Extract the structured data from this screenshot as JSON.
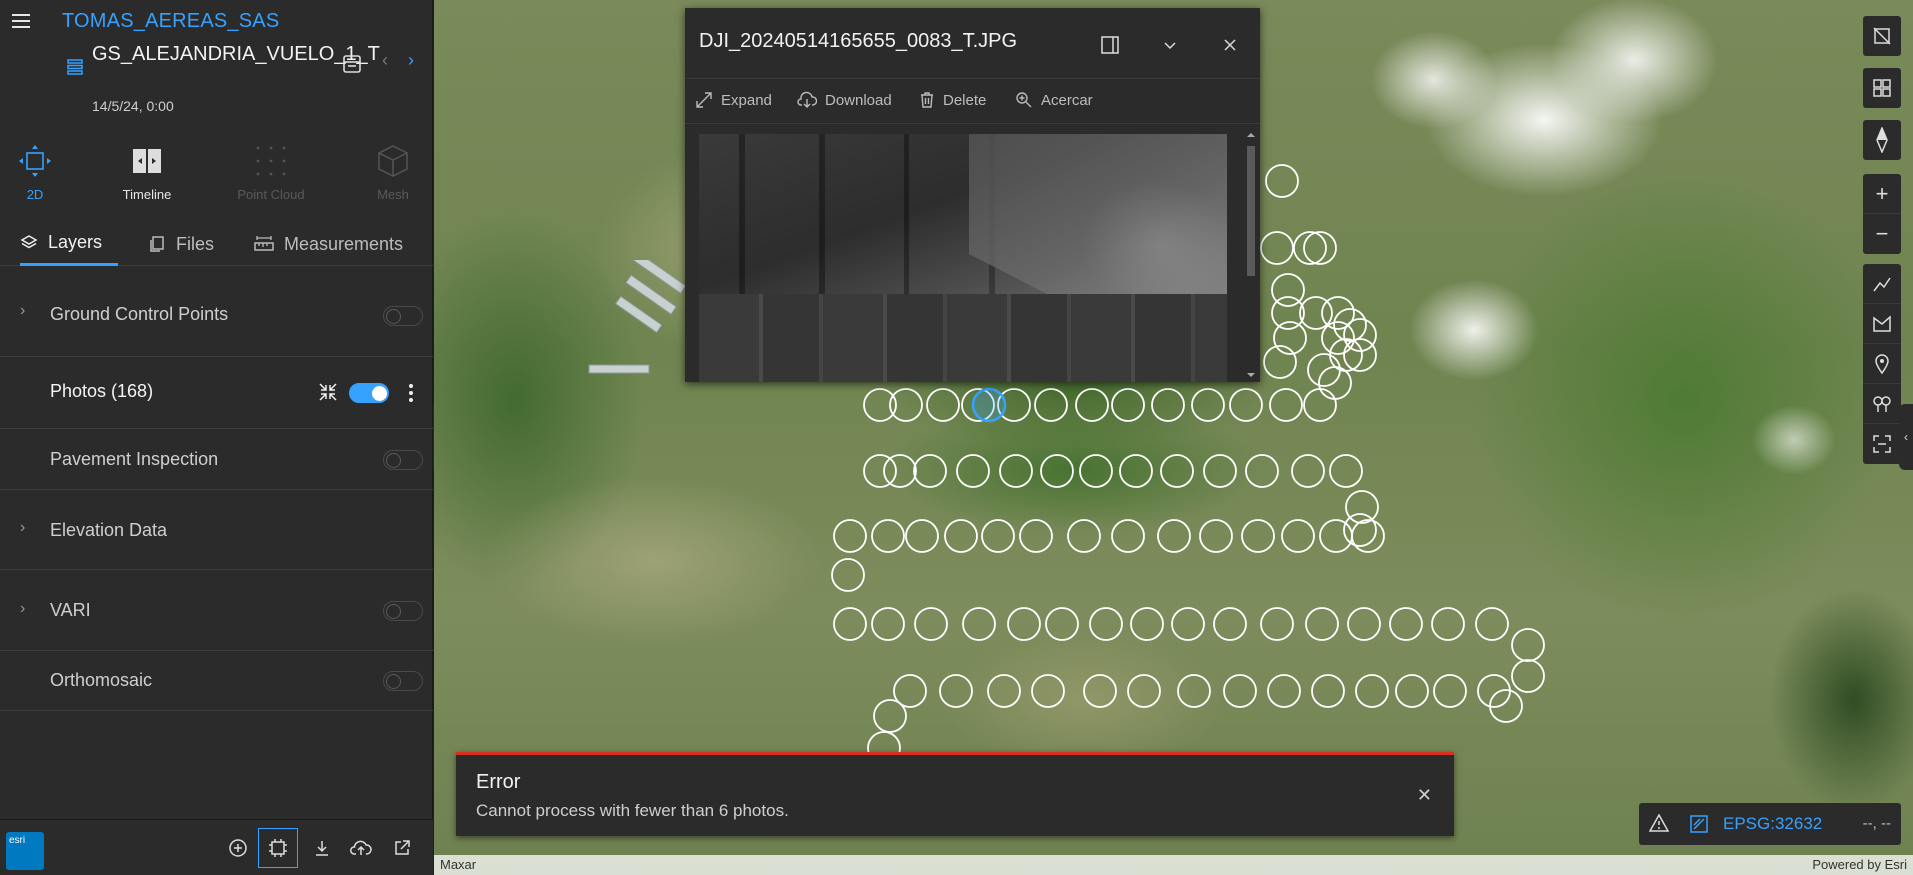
{
  "header": {
    "org": "TOMAS_AEREAS_SAS",
    "project": "GS_ALEJANDRIA_VUELO_1_T",
    "date": "14/5/24, 0:00"
  },
  "modes": [
    {
      "label": "2D",
      "state": "active"
    },
    {
      "label": "Timeline",
      "state": "enabled"
    },
    {
      "label": "Point Cloud",
      "state": "disabled"
    },
    {
      "label": "Mesh",
      "state": "disabled"
    }
  ],
  "tabs": [
    {
      "label": "Layers",
      "active": true
    },
    {
      "label": "Files",
      "active": false
    },
    {
      "label": "Measurements",
      "active": false
    }
  ],
  "layers": [
    {
      "name": "Ground Control Points",
      "expandable": true,
      "visible": false
    },
    {
      "name": "Photos (168)",
      "expandable": false,
      "visible": true
    },
    {
      "name": "Pavement Inspection",
      "expandable": false,
      "visible": false
    },
    {
      "name": "Elevation Data",
      "expandable": true,
      "visible": false
    },
    {
      "name": "VARI",
      "expandable": true,
      "visible": false
    },
    {
      "name": "Orthomosaic",
      "expandable": false,
      "visible": false
    }
  ],
  "popup": {
    "title": "DJI_20240514165655_0083_T.JPG",
    "actions": {
      "expand": "Expand",
      "download": "Download",
      "delete": "Delete",
      "zoom": "Acercar"
    }
  },
  "coords": {
    "srs": "EPSG:32632",
    "xy": "--, --"
  },
  "toast": {
    "title": "Error",
    "message": "Cannot process with fewer than 6 photos."
  },
  "attribution": {
    "left": "Maxar",
    "right": "Powered by Esri"
  },
  "logo": {
    "text": "esri"
  },
  "colors": {
    "accent": "#35a2ff",
    "error": "#d83020",
    "panel": "#2b2b2b"
  }
}
